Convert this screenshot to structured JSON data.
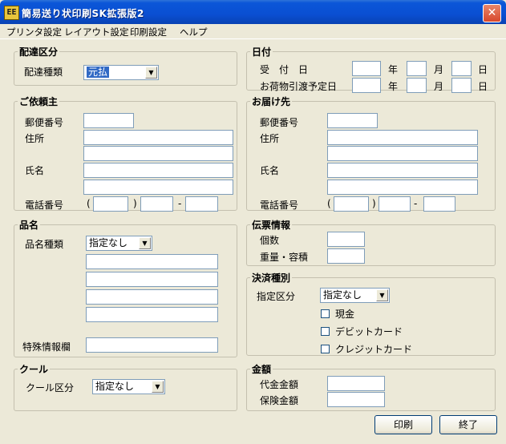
{
  "window": {
    "title": "簡易送り状印刷SK拡張版2",
    "icon_text": "EE",
    "close_label": "✕"
  },
  "menu": [
    "プリンタ設定",
    "レイアウト設定",
    "印刷設定",
    "ヘルプ"
  ],
  "delivery": {
    "legend": "配達区分",
    "type_label": "配達種類",
    "type_value": "元払"
  },
  "date": {
    "legend": "日付",
    "ship_label": "受　付　日",
    "pickup_label": "お荷物引渡予定日",
    "year": "年",
    "month": "月",
    "day": "日"
  },
  "sender": {
    "legend": "ご依頼主",
    "postal_label": "郵便番号",
    "address_label": "住所",
    "name_label": "氏名",
    "phone_label": "電話番号",
    "paren_open": "(",
    "paren_close": ")",
    "dash": "-"
  },
  "recipient": {
    "legend": "お届け先",
    "postal_label": "郵便番号",
    "address_label": "住所",
    "name_label": "氏名",
    "phone_label": "電話番号",
    "paren_open": "(",
    "paren_close": ")",
    "dash": "-"
  },
  "item": {
    "legend": "品名",
    "type_label": "品名種類",
    "type_value": "指定なし",
    "special_label": "特殊情報欄"
  },
  "slip": {
    "legend": "伝票情報",
    "count_label": "個数",
    "weight_label": "重量・容積"
  },
  "payment": {
    "legend": "決済種別",
    "type_label": "指定区分",
    "type_value": "指定なし",
    "cash": "現金",
    "debit": "デビットカード",
    "credit": "クレジットカード"
  },
  "cool": {
    "legend": "クール",
    "type_label": "クール区分",
    "type_value": "指定なし"
  },
  "amount": {
    "legend": "金額",
    "cod_label": "代金金額",
    "insurance_label": "保険金額"
  },
  "buttons": {
    "print": "印刷",
    "exit": "終了"
  }
}
